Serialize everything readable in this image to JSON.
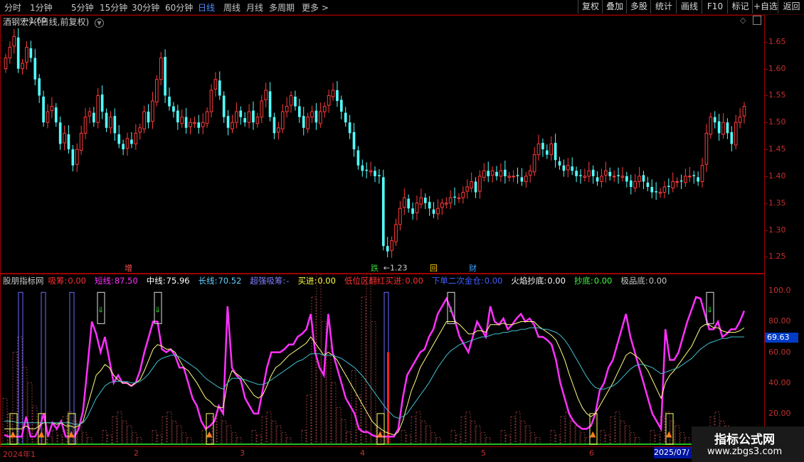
{
  "toolbar": {
    "tabs": [
      "分时",
      "1分钟",
      "5分钟",
      "15分钟",
      "30分钟",
      "60分钟",
      "日线",
      "周线",
      "月线",
      "多周期",
      "更多 >"
    ],
    "active_tab": "日线",
    "right_buttons": [
      "复权",
      "叠加",
      "多股",
      "统计",
      "画线",
      "F10",
      "标记",
      "+自选",
      "返回"
    ]
  },
  "main": {
    "title": "酒钢宏兴(日线,前复权)",
    "high_label": "1.69",
    "low_label": "1.23",
    "event_marks": [
      {
        "text": "增",
        "color": "#ff5050"
      },
      {
        "text": "跌",
        "color": "#30d030"
      },
      {
        "text": "回",
        "color": "#ffcc00"
      },
      {
        "text": "财",
        "color": "#40a0ff"
      }
    ],
    "y_ticks": [
      "1.65",
      "1.60",
      "1.55",
      "1.50",
      "1.45",
      "1.40",
      "1.35",
      "1.30",
      "1.25"
    ]
  },
  "sub": {
    "name": "股朋指标网",
    "indicators": [
      {
        "label": "吸筹:",
        "value": "0.00",
        "color": "#ff3030"
      },
      {
        "label": "短线:",
        "value": "87.50",
        "color": "#ff30ff"
      },
      {
        "label": "中线:",
        "value": "75.96",
        "color": "#ffffff"
      },
      {
        "label": "长线:",
        "value": "70.52",
        "color": "#60d0ff"
      },
      {
        "label": "超强吸筹:",
        "value": "-",
        "color": "#8080ff"
      },
      {
        "label": "买进:",
        "value": "0.00",
        "color": "#ffff40"
      },
      {
        "label": "低位区翻红买进:",
        "value": "0.00",
        "color": "#ff3030"
      },
      {
        "label": "下单二次金仓:",
        "value": "0.00",
        "color": "#4060ff"
      },
      {
        "label": "火焰抄底:",
        "value": "0.00",
        "color": "#ffffff"
      },
      {
        "label": "抄底:",
        "value": "0.00",
        "color": "#40ff40"
      },
      {
        "label": "极品底:",
        "value": "0.00",
        "color": "#c8c8c8"
      }
    ],
    "y_ticks": [
      "100.0",
      "80.00",
      "60.00",
      "40.00",
      "20.00"
    ],
    "current_value": "69.63"
  },
  "dates": [
    "2024年1",
    "2",
    "3",
    "4",
    "5",
    "6",
    "2025/07/"
  ],
  "watermark": {
    "title": "指标公式网",
    "url": "www.zbgs3.com"
  },
  "colors": {
    "up": "#ff3c3c",
    "down": "#54ffff",
    "grid": "#a00000",
    "short": "#ff30ff",
    "mid": "#ffff80",
    "long": "#40c0d0"
  },
  "chart_data": [
    {
      "type": "candlestick",
      "title": "酒钢宏兴(日线,前复权)",
      "ylim": [
        1.22,
        1.7
      ],
      "annotations": {
        "high": 1.69,
        "low": 1.23
      },
      "close": [
        1.62,
        1.64,
        1.66,
        1.6,
        1.61,
        1.64,
        1.62,
        1.58,
        1.55,
        1.5,
        1.52,
        1.53,
        1.5,
        1.46,
        1.48,
        1.45,
        1.42,
        1.45,
        1.48,
        1.51,
        1.52,
        1.5,
        1.55,
        1.52,
        1.49,
        1.51,
        1.48,
        1.46,
        1.45,
        1.47,
        1.46,
        1.48,
        1.49,
        1.52,
        1.5,
        1.54,
        1.58,
        1.62,
        1.55,
        1.53,
        1.52,
        1.5,
        1.51,
        1.49,
        1.5,
        1.5,
        1.49,
        1.5,
        1.52,
        1.56,
        1.58,
        1.55,
        1.51,
        1.49,
        1.5,
        1.52,
        1.51,
        1.5,
        1.52,
        1.5,
        1.51,
        1.54,
        1.56,
        1.51,
        1.48,
        1.49,
        1.52,
        1.53,
        1.55,
        1.53,
        1.51,
        1.49,
        1.51,
        1.52,
        1.5,
        1.52,
        1.53,
        1.55,
        1.56,
        1.54,
        1.52,
        1.5,
        1.48,
        1.45,
        1.42,
        1.41,
        1.41,
        1.41,
        1.4,
        1.4,
        1.27,
        1.26,
        1.28,
        1.31,
        1.34,
        1.36,
        1.34,
        1.33,
        1.35,
        1.36,
        1.35,
        1.34,
        1.33,
        1.34,
        1.35,
        1.35,
        1.36,
        1.36,
        1.36,
        1.37,
        1.38,
        1.39,
        1.37,
        1.4,
        1.41,
        1.4,
        1.41,
        1.4,
        1.41,
        1.4,
        1.4,
        1.4,
        1.4,
        1.39,
        1.4,
        1.41,
        1.44,
        1.46,
        1.45,
        1.44,
        1.46,
        1.43,
        1.42,
        1.41,
        1.42,
        1.41,
        1.4,
        1.4,
        1.4,
        1.41,
        1.4,
        1.39,
        1.4,
        1.41,
        1.4,
        1.4,
        1.4,
        1.4,
        1.39,
        1.38,
        1.39,
        1.4,
        1.39,
        1.38,
        1.37,
        1.37,
        1.37,
        1.38,
        1.38,
        1.39,
        1.39,
        1.39,
        1.4,
        1.4,
        1.4,
        1.39,
        1.42,
        1.48,
        1.51,
        1.5,
        1.48,
        1.5,
        1.48,
        1.46,
        1.5,
        1.51,
        1.53
      ]
    },
    {
      "type": "line",
      "title": "股朋指标网",
      "ylim": [
        0,
        102
      ],
      "series": [
        {
          "name": "短线",
          "values": [
            6,
            5,
            5,
            5,
            5,
            18,
            5,
            5,
            10,
            20,
            5,
            14,
            10,
            15,
            5,
            5,
            5,
            10,
            22,
            50,
            80,
            72,
            60,
            70,
            55,
            40,
            45,
            40,
            40,
            38,
            40,
            48,
            60,
            70,
            80,
            80,
            62,
            60,
            62,
            58,
            50,
            50,
            40,
            30,
            25,
            15,
            10,
            12,
            15,
            25,
            20,
            90,
            50,
            45,
            42,
            30,
            25,
            20,
            20,
            35,
            50,
            60,
            60,
            60,
            62,
            65,
            65,
            70,
            72,
            75,
            85,
            60,
            50,
            45,
            85,
            60,
            50,
            40,
            30,
            25,
            20,
            10,
            8,
            8,
            6,
            5,
            5,
            5,
            5,
            5,
            10,
            30,
            45,
            50,
            55,
            60,
            62,
            70,
            75,
            85,
            90,
            95,
            88,
            80,
            70,
            65,
            60,
            70,
            80,
            75,
            70,
            90,
            80,
            78,
            82,
            75,
            78,
            82,
            85,
            80,
            82,
            78,
            70,
            70,
            68,
            65,
            55,
            40,
            30,
            20,
            15,
            12,
            10,
            10,
            12,
            20,
            35,
            40,
            50,
            55,
            65,
            75,
            85,
            70,
            60,
            50,
            40,
            30,
            20,
            15,
            10,
            75,
            55,
            55,
            60,
            70,
            80,
            88,
            96,
            95,
            85,
            75,
            75,
            80,
            70,
            72,
            75,
            75,
            80,
            87
          ]
        },
        {
          "name": "中线",
          "values": [
            10,
            10,
            10,
            10,
            10,
            12,
            10,
            10,
            12,
            14,
            14,
            14,
            13,
            14,
            12,
            12,
            11,
            12,
            15,
            25,
            35,
            45,
            48,
            52,
            50,
            45,
            42,
            40,
            40,
            38,
            40,
            42,
            48,
            55,
            62,
            65,
            64,
            62,
            62,
            60,
            55,
            50,
            48,
            44,
            40,
            35,
            30,
            28,
            25,
            24,
            24,
            40,
            48,
            46,
            44,
            40,
            36,
            32,
            30,
            32,
            38,
            45,
            50,
            52,
            55,
            58,
            60,
            62,
            64,
            66,
            70,
            66,
            62,
            58,
            60,
            58,
            55,
            50,
            45,
            40,
            35,
            30,
            25,
            20,
            15,
            12,
            10,
            8,
            7,
            6,
            8,
            15,
            25,
            35,
            42,
            50,
            55,
            60,
            65,
            70,
            75,
            80,
            80,
            80,
            78,
            75,
            72,
            72,
            74,
            74,
            73,
            78,
            78,
            78,
            79,
            78,
            78,
            79,
            80,
            80,
            80,
            80,
            77,
            75,
            73,
            71,
            68,
            62,
            55,
            46,
            38,
            30,
            24,
            20,
            18,
            20,
            25,
            30,
            35,
            40,
            46,
            52,
            58,
            60,
            58,
            56,
            52,
            48,
            42,
            36,
            30,
            40,
            45,
            48,
            52,
            56,
            60,
            64,
            70,
            76,
            78,
            78,
            76,
            76,
            74,
            73,
            73,
            73,
            74,
            76
          ]
        },
        {
          "name": "长线",
          "values": [
            15,
            15,
            15,
            14,
            14,
            14,
            14,
            14,
            14,
            14,
            14,
            14,
            14,
            14,
            14,
            14,
            13,
            13,
            14,
            18,
            24,
            30,
            34,
            38,
            40,
            41,
            41,
            41,
            41,
            40,
            40,
            41,
            43,
            46,
            50,
            54,
            56,
            57,
            58,
            58,
            57,
            55,
            53,
            51,
            49,
            46,
            43,
            41,
            39,
            37,
            36,
            40,
            43,
            43,
            43,
            42,
            41,
            40,
            39,
            39,
            40,
            42,
            44,
            46,
            48,
            50,
            52,
            54,
            55,
            57,
            59,
            59,
            59,
            58,
            58,
            58,
            57,
            56,
            54,
            52,
            50,
            47,
            44,
            40,
            36,
            32,
            28,
            24,
            21,
            18,
            17,
            18,
            20,
            24,
            28,
            32,
            36,
            40,
            45,
            50,
            54,
            58,
            61,
            63,
            65,
            66,
            67,
            68,
            69,
            70,
            70,
            71,
            72,
            72,
            73,
            73,
            74,
            74,
            75,
            75,
            76,
            76,
            76,
            75,
            75,
            74,
            73,
            71,
            68,
            64,
            59,
            54,
            49,
            44,
            40,
            37,
            36,
            36,
            37,
            38,
            40,
            43,
            46,
            49,
            51,
            52,
            52,
            51,
            50,
            48,
            46,
            47,
            48,
            49,
            50,
            52,
            54,
            56,
            59,
            62,
            64,
            66,
            67,
            68,
            69,
            69,
            70,
            70,
            70,
            70
          ]
        }
      ]
    }
  ]
}
